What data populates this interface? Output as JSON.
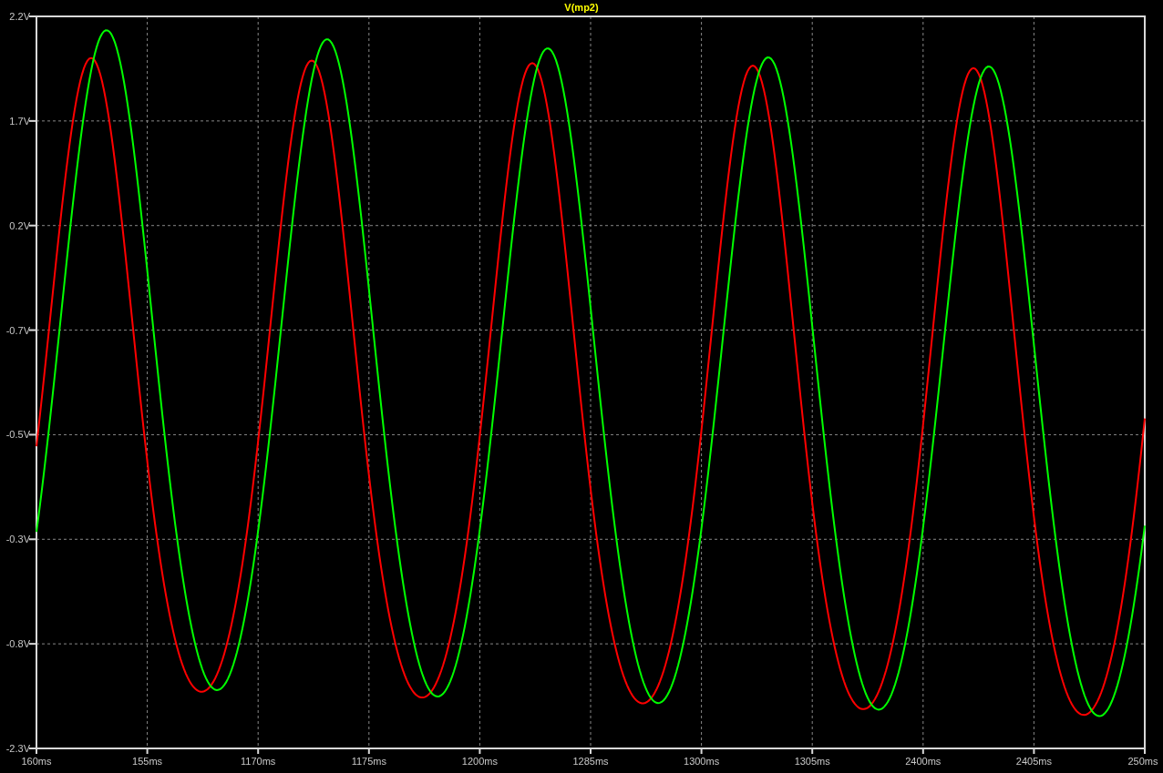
{
  "plot": {
    "title": "V(mp2)",
    "y_tick_labels": [
      "2.2V",
      "1.7V",
      "0.2V",
      "-0.7V",
      "-0.5V",
      "-0.3V",
      "-0.8V",
      "-2.3V"
    ],
    "x_tick_labels": [
      "160ms",
      "155ms",
      "1170ms",
      "1175ms",
      "1200ms",
      "1285ms",
      "1300ms",
      "1305ms",
      "2400ms",
      "2405ms",
      "250ms"
    ]
  }
}
